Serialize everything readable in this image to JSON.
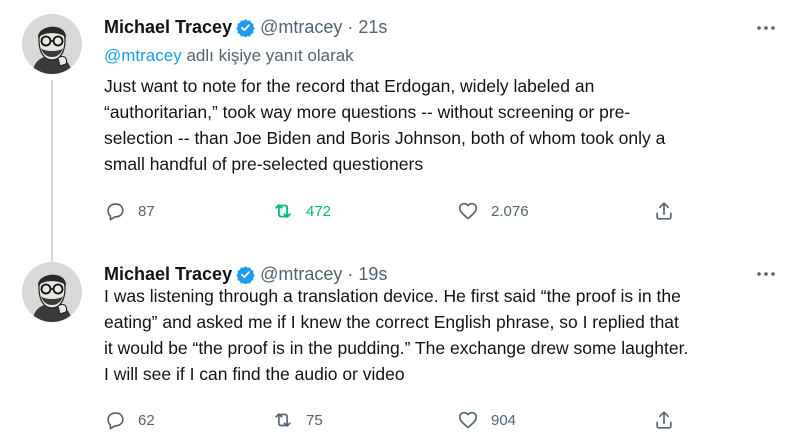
{
  "tweets": [
    {
      "author_name": "Michael Tracey",
      "handle": "@mtracey",
      "separator": "·",
      "time": "21s",
      "reply_mention": "@mtracey",
      "reply_suffix": " adlı kişiye yanıt olarak",
      "lines": [
        "Just want to note for the record that Erdogan, widely labeled an",
        "“authoritarian,” took way more questions -- without screening or pre-",
        "selection -- than Joe Biden and Boris Johnson, both of whom took only a",
        "small handful of pre-selected questioners"
      ],
      "replies": "87",
      "retweets": "472",
      "retweeted": true,
      "likes": "2.076"
    },
    {
      "author_name": "Michael Tracey",
      "handle": "@mtracey",
      "separator": "·",
      "time": "19s",
      "lines": [
        "I was listening through a translation device. He first said “the proof is in the",
        "eating” and asked me if I knew the correct English phrase, so I replied that",
        "it would be “the proof is in the pudding.” The exchange drew some laughter.",
        "I will see if I can find the audio or video"
      ],
      "replies": "62",
      "retweets": "75",
      "retweeted": false,
      "likes": "904"
    }
  ],
  "colors": {
    "accent": "#1d9bf0",
    "retweet_active": "#00ba7c",
    "muted": "#536471",
    "text": "#0f1419"
  },
  "icons": [
    "verified-badge-icon",
    "more-icon",
    "reply-icon",
    "retweet-icon",
    "like-icon",
    "share-icon"
  ]
}
